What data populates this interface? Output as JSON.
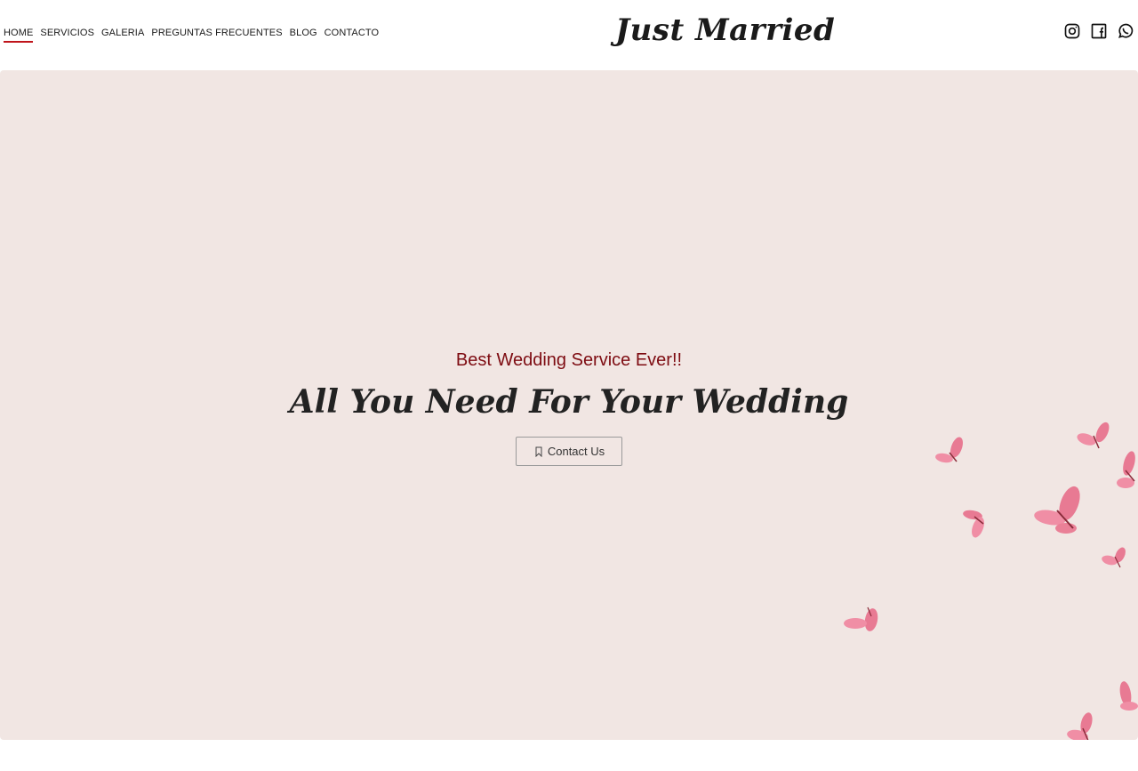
{
  "nav": {
    "items": [
      {
        "label": "HOME",
        "active": true
      },
      {
        "label": "SERVICIOS",
        "active": false
      },
      {
        "label": "GALERIA",
        "active": false
      },
      {
        "label": "PREGUNTAS FRECUENTES",
        "active": false
      },
      {
        "label": "BLOG",
        "active": false
      },
      {
        "label": "CONTACTO",
        "active": false
      }
    ]
  },
  "logo": {
    "text": "Just Married"
  },
  "social": {
    "icons": [
      "instagram-icon",
      "facebook-icon",
      "whatsapp-icon"
    ]
  },
  "hero": {
    "subtitle": "Best Wedding Service Ever!!",
    "title": "All You Need For Your Wedding",
    "cta_label": "Contact Us",
    "cta_icon": "bookmark-icon",
    "background_color": "#f1e6e3",
    "decoration": "butterfly-icon"
  },
  "colors": {
    "accent": "#c0141b",
    "subtitle": "#7e0c12",
    "butterfly": "#e87a93"
  }
}
